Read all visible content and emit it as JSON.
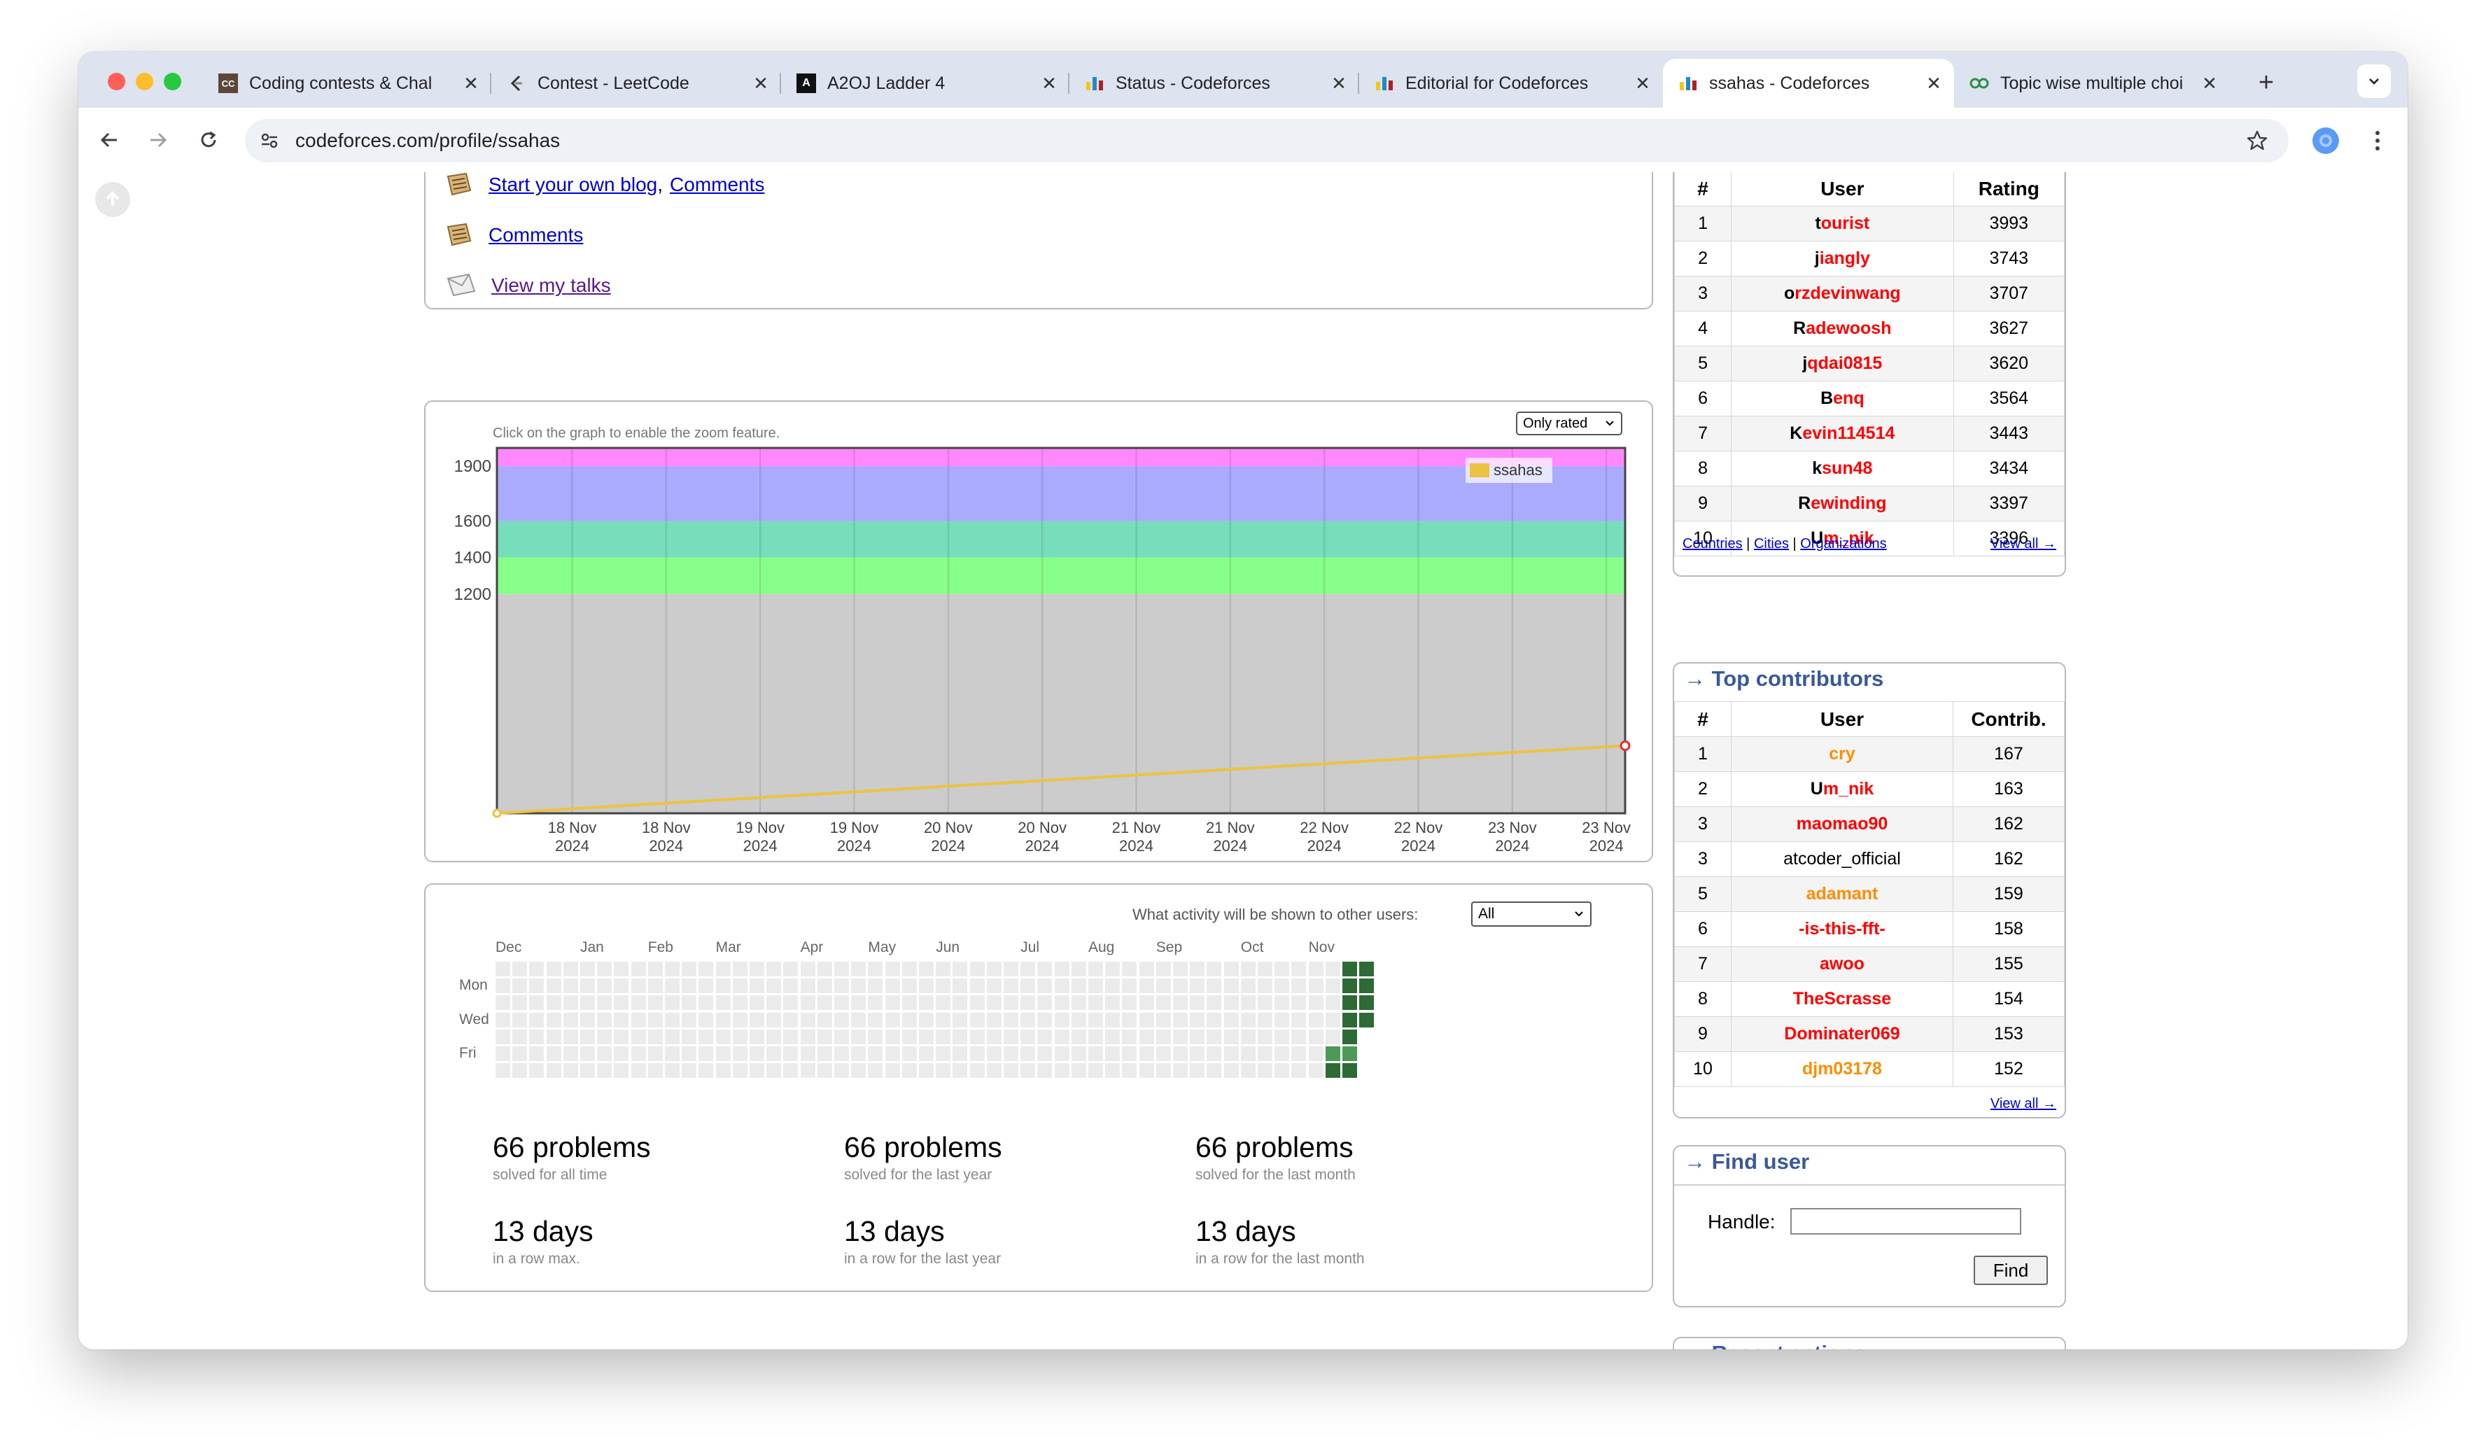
{
  "browser": {
    "tabs": [
      {
        "title": "Coding contests & Chal",
        "icon": "codechef-icon"
      },
      {
        "title": "Contest - LeetCode",
        "icon": "leetcode-icon"
      },
      {
        "title": "A2OJ Ladder 4",
        "icon": "a2oj-icon"
      },
      {
        "title": "Status - Codeforces",
        "icon": "codeforces-icon"
      },
      {
        "title": "Editorial for Codeforces",
        "icon": "codeforces-icon"
      },
      {
        "title": "ssahas - Codeforces",
        "icon": "codeforces-icon",
        "active": true
      },
      {
        "title": "Topic wise multiple choi",
        "icon": "gfg-icon"
      }
    ],
    "url": "codeforces.com/profile/ssahas"
  },
  "blog_links": {
    "start_blog": "Start your own blog",
    "comma": ",",
    "comments_1": "Comments",
    "comments_2": "Comments",
    "talks": "View my talks"
  },
  "rating_graph": {
    "hint": "Click on the graph to enable the zoom feature.",
    "select_value": "Only rated",
    "legend": "ssahas"
  },
  "chart_data": {
    "type": "line",
    "series": [
      {
        "name": "ssahas",
        "x_index": [
          0,
          12
        ],
        "values": [
          0,
          370
        ]
      }
    ],
    "yticks": [
      1200,
      1400,
      1600,
      1900
    ],
    "x_ticks": [
      [
        "18 Nov",
        "2024"
      ],
      [
        "18 Nov",
        "2024"
      ],
      [
        "19 Nov",
        "2024"
      ],
      [
        "19 Nov",
        "2024"
      ],
      [
        "20 Nov",
        "2024"
      ],
      [
        "20 Nov",
        "2024"
      ],
      [
        "21 Nov",
        "2024"
      ],
      [
        "21 Nov",
        "2024"
      ],
      [
        "22 Nov",
        "2024"
      ],
      [
        "22 Nov",
        "2024"
      ],
      [
        "23 Nov",
        "2024"
      ],
      [
        "23 Nov",
        "2024"
      ]
    ],
    "bands": [
      {
        "from": 0,
        "to": 1200,
        "color": "#cccccc"
      },
      {
        "from": 1200,
        "to": 1400,
        "color": "#88ff88"
      },
      {
        "from": 1400,
        "to": 1600,
        "color": "#77ddbb"
      },
      {
        "from": 1600,
        "to": 1900,
        "color": "#aaaaff"
      },
      {
        "from": 1900,
        "to": 2000,
        "color": "#ff88ff"
      }
    ],
    "ylim": [
      0,
      2000
    ],
    "grid": true,
    "legend_position": "top-right"
  },
  "activity": {
    "question": "What activity will be shown to other users:",
    "select_value": "All",
    "months": [
      "Dec",
      "Jan",
      "Feb",
      "Mar",
      "Apr",
      "May",
      "Jun",
      "Jul",
      "Aug",
      "Sep",
      "Oct",
      "Nov"
    ],
    "days": [
      "Mon",
      "Wed",
      "Fri"
    ],
    "stats": [
      {
        "big": "66 problems",
        "small": "solved for all time"
      },
      {
        "big": "66 problems",
        "small": "solved for the last year"
      },
      {
        "big": "66 problems",
        "small": "solved for the last month"
      },
      {
        "big": "13 days",
        "small": "in a row max."
      },
      {
        "big": "13 days",
        "small": "in a row for the last year"
      },
      {
        "big": "13 days",
        "small": "in a row for the last month"
      }
    ]
  },
  "top_rated": {
    "headers": [
      "#",
      "User",
      "Rating"
    ],
    "rows": [
      {
        "rank": "1",
        "first": "t",
        "rest": "ourist",
        "value": "3993",
        "color": "#ff0000"
      },
      {
        "rank": "2",
        "first": "j",
        "rest": "iangly",
        "value": "3743",
        "color": "#ff0000"
      },
      {
        "rank": "3",
        "first": "o",
        "rest": "rzdevinwang",
        "value": "3707",
        "color": "#ff0000"
      },
      {
        "rank": "4",
        "first": "R",
        "rest": "adewoosh",
        "value": "3627",
        "color": "#ff0000"
      },
      {
        "rank": "5",
        "first": "j",
        "rest": "qdai0815",
        "value": "3620",
        "color": "#ff0000"
      },
      {
        "rank": "6",
        "first": "B",
        "rest": "enq",
        "value": "3564",
        "color": "#ff0000"
      },
      {
        "rank": "7",
        "first": "K",
        "rest": "evin114514",
        "value": "3443",
        "color": "#ff0000"
      },
      {
        "rank": "8",
        "first": "k",
        "rest": "sun48",
        "value": "3434",
        "color": "#ff0000"
      },
      {
        "rank": "9",
        "first": "R",
        "rest": "ewinding",
        "value": "3397",
        "color": "#ff0000"
      },
      {
        "rank": "10",
        "first": "U",
        "rest": "m_nik",
        "value": "3396",
        "color": "#ff0000"
      }
    ],
    "footer_links": [
      "Countries",
      "Cities",
      "Organizations"
    ],
    "footer_sep": "|",
    "view_all": "View all →"
  },
  "top_contributors": {
    "title": "→ Top contributors",
    "headers": [
      "#",
      "User",
      "Contrib."
    ],
    "rows": [
      {
        "rank": "1",
        "first": "",
        "rest": "cry",
        "value": "167",
        "color": "#ff8c00"
      },
      {
        "rank": "2",
        "first": "U",
        "rest": "m_nik",
        "value": "163",
        "color": "#ff0000"
      },
      {
        "rank": "3",
        "first": "",
        "rest": "maomao90",
        "value": "162",
        "color": "#ff0000"
      },
      {
        "rank": "3",
        "first": "",
        "rest": "atcoder_official",
        "value": "162",
        "color": "#000000",
        "plain": true
      },
      {
        "rank": "5",
        "first": "",
        "rest": "adamant",
        "value": "159",
        "color": "#ff8c00"
      },
      {
        "rank": "6",
        "first": "",
        "rest": "-is-this-fft-",
        "value": "158",
        "color": "#ff0000"
      },
      {
        "rank": "7",
        "first": "",
        "rest": "awoo",
        "value": "155",
        "color": "#ff0000"
      },
      {
        "rank": "8",
        "first": "",
        "rest": "TheScrasse",
        "value": "154",
        "color": "#ff0000"
      },
      {
        "rank": "9",
        "first": "",
        "rest": "Dominater069",
        "value": "153",
        "color": "#ff0000"
      },
      {
        "rank": "10",
        "first": "",
        "rest": "djm03178",
        "value": "152",
        "color": "#ff8c00"
      }
    ],
    "view_all": "View all →"
  },
  "find_user": {
    "title": "→ Find user",
    "label": "Handle:",
    "button": "Find",
    "input_value": ""
  },
  "recent_actions": {
    "title": "→ Recent actions"
  }
}
